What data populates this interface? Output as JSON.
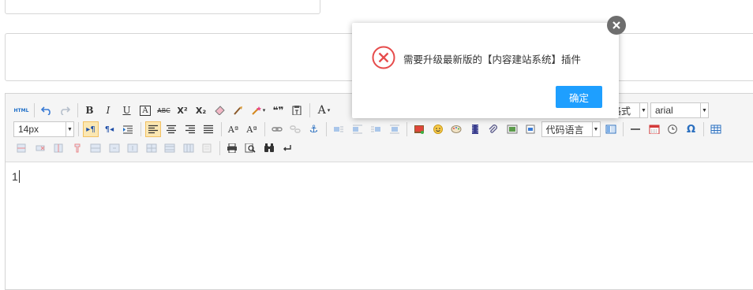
{
  "editor": {
    "toolbar": {
      "font_size": "14px",
      "paragraph_format": "段落格式",
      "font_family": "arial",
      "code_language": "代码语言",
      "icons": {
        "html": "HTML",
        "bold": "B",
        "italic": "I",
        "underline": "U",
        "font_border": "A",
        "strikethrough": "ABC",
        "superscript": "X²",
        "subscript": "X₂",
        "blockquote": "❝❞",
        "forecolor": "A",
        "omega": "Ω"
      }
    },
    "content": "1"
  },
  "dialog": {
    "message": "需要升级最新版的【内容建站系统】插件",
    "confirm_label": "确定",
    "colors": {
      "accent": "#1e9fff",
      "error": "#e64b4b"
    }
  }
}
